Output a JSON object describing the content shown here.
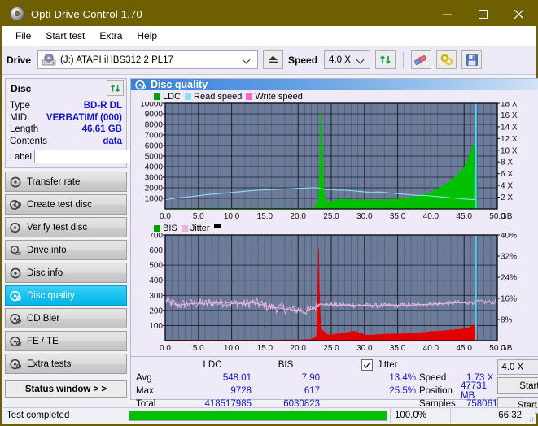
{
  "window": {
    "title": "Opti Drive Control 1.70",
    "icon": "disc-icon",
    "minimize": "–",
    "maximize": "□",
    "close": "✕"
  },
  "menubar": {
    "items": [
      {
        "label": "File"
      },
      {
        "label": "Start test"
      },
      {
        "label": "Extra"
      },
      {
        "label": "Help"
      }
    ]
  },
  "toolbar": {
    "drive_label": "Drive",
    "drive_value": "(J:)   ATAPI iHBS312  2 PL17",
    "eject_title": "eject-button",
    "speed_label": "Speed",
    "speed_value": "4.0 X",
    "refresh_title": "refresh-button",
    "erase_title": "erase-button",
    "tools_title": "tools-button",
    "save_title": "save-button"
  },
  "disc_panel": {
    "title": "Disc",
    "refresh_title": "refresh-disc-button",
    "rows": [
      {
        "key": "Type",
        "value": "BD-R DL"
      },
      {
        "key": "MID",
        "value": "VERBATIMf (000)"
      },
      {
        "key": "Length",
        "value": "46.61 GB"
      },
      {
        "key": "Contents",
        "value": "data"
      }
    ],
    "label_key": "Label",
    "label_value": "",
    "label_placeholder": ""
  },
  "nav": {
    "items": [
      {
        "label": "Transfer rate",
        "active": false
      },
      {
        "label": "Create test disc",
        "active": false
      },
      {
        "label": "Verify test disc",
        "active": false
      },
      {
        "label": "Drive info",
        "active": false
      },
      {
        "label": "Disc info",
        "active": false
      },
      {
        "label": "Disc quality",
        "active": true
      },
      {
        "label": "CD Bler",
        "active": false
      },
      {
        "label": "FE / TE",
        "active": false
      },
      {
        "label": "Extra tests",
        "active": false
      }
    ],
    "status_window": "Status window > >"
  },
  "main": {
    "header_title": "Disc quality",
    "header_icon": "disc-quality-icon"
  },
  "stats": {
    "col_headers": [
      "LDC",
      "BIS"
    ],
    "jitter_label": "Jitter",
    "jitter_checked": true,
    "rows": [
      {
        "label": "Avg",
        "ldc": "548.01",
        "bis": "7.90",
        "jitter": "13.4%"
      },
      {
        "label": "Max",
        "ldc": "9728",
        "bis": "617",
        "jitter": "25.5%"
      },
      {
        "label": "Total",
        "ldc": "418517985",
        "bis": "6030823",
        "jitter": ""
      }
    ],
    "right": [
      {
        "label": "Speed",
        "value": "1.73 X"
      },
      {
        "label": "Position",
        "value": "47731 MB"
      },
      {
        "label": "Samples",
        "value": "758061"
      }
    ],
    "speed_select": "4.0 X",
    "start_full": "Start full",
    "start_part": "Start part"
  },
  "statusbar": {
    "text": "Test completed",
    "progress_percent": "100.0%",
    "progress_value": 100,
    "elapsed": "66:32"
  },
  "colors": {
    "titlebar": "#6e6000",
    "accent_blue": "#1414c8",
    "plot_bg": "#6b7b99",
    "grid": "#2a2a33",
    "ldc_green": "#00c000",
    "bis_red": "#e00000",
    "bis_orange": "#f0a000",
    "jitter_pink": "#e6b4e0",
    "read_speed": "#8fdcf5",
    "write_speed": "#ff66cc",
    "progress_green": "#00c000",
    "nav_active": "#16c2ef"
  },
  "chart_data": [
    {
      "id": "ldc-chart",
      "type": "area",
      "title": "",
      "xlabel": "GB",
      "ylabel": "",
      "legend": [
        {
          "name": "LDC",
          "color": "#00a000"
        },
        {
          "name": "Read speed",
          "color": "#8fdcf5"
        },
        {
          "name": "Write speed",
          "color": "#ff66cc"
        }
      ],
      "legend_position": "top-left",
      "grid": true,
      "xlim": [
        0,
        50
      ],
      "xticks": [
        "0.0",
        "5.0",
        "10.0",
        "15.0",
        "20.0",
        "25.0",
        "30.0",
        "35.0",
        "40.0",
        "45.0",
        "50.0"
      ],
      "xtick_suffix": "GB",
      "ylim": [
        0,
        10000
      ],
      "yticks": [
        "10000",
        "9000",
        "8000",
        "7000",
        "6000",
        "5000",
        "4000",
        "3000",
        "2000",
        "1000"
      ],
      "y2lim": [
        0,
        18
      ],
      "y2ticks": [
        "18 X",
        "16 X",
        "14 X",
        "12 X",
        "10 X",
        "8 X",
        "6 X",
        "4 X",
        "2 X"
      ],
      "series": [
        {
          "name": "LDC",
          "color": "#00c000",
          "kind": "area",
          "x": [
            0,
            1,
            2,
            3,
            4,
            5,
            6,
            7,
            8,
            9,
            10,
            11,
            12,
            13,
            14,
            15,
            16,
            17,
            18,
            19,
            20,
            21,
            22,
            22.5,
            23,
            23.2,
            23.4,
            23.6,
            23.8,
            24,
            24.3,
            24.6,
            25,
            25.5,
            26,
            26.5,
            27,
            27.5,
            28,
            28.5,
            29,
            29.5,
            30,
            31,
            32,
            33,
            34,
            35,
            36,
            37,
            38,
            39,
            40,
            41,
            42,
            43,
            44,
            45,
            45.5,
            46,
            46.3,
            46.6,
            46.8,
            47
          ],
          "y": [
            60,
            60,
            60,
            60,
            60,
            60,
            60,
            60,
            60,
            60,
            60,
            60,
            60,
            60,
            60,
            60,
            60,
            60,
            60,
            60,
            60,
            60,
            70,
            120,
            600,
            3000,
            9728,
            7000,
            3000,
            1400,
            700,
            640,
            760,
            820,
            860,
            900,
            920,
            900,
            880,
            880,
            870,
            860,
            850,
            840,
            850,
            880,
            900,
            940,
            1000,
            1100,
            1250,
            1400,
            1600,
            1900,
            2250,
            2700,
            3250,
            3900,
            4600,
            5400,
            5900,
            6150,
            6200,
            80
          ]
        },
        {
          "name": "Read speed",
          "color": "#8fdcf5",
          "kind": "line",
          "axis": "y2",
          "x": [
            0,
            2,
            4,
            6,
            8,
            10,
            12,
            14,
            16,
            18,
            20,
            22,
            23,
            24,
            25,
            26,
            27,
            28,
            29,
            30,
            31,
            32,
            33,
            34,
            35,
            36,
            37,
            38,
            39,
            40,
            41,
            42,
            43,
            44,
            45,
            46,
            46.6,
            46.7,
            46.8
          ],
          "y": [
            1.6,
            1.9,
            2.1,
            2.4,
            2.6,
            2.8,
            3.0,
            3.2,
            3.3,
            3.4,
            3.5,
            3.6,
            3.6,
            3.3,
            3.3,
            3.2,
            3.2,
            3.1,
            3.0,
            2.9,
            2.8,
            2.9,
            2.8,
            2.7,
            2.6,
            2.5,
            2.4,
            2.3,
            2.3,
            2.2,
            2.1,
            2.0,
            1.9,
            1.8,
            1.7,
            1.6,
            1.6,
            18,
            18
          ]
        }
      ]
    },
    {
      "id": "bis-chart",
      "type": "area",
      "title": "",
      "xlabel": "GB",
      "legend": [
        {
          "name": "BIS",
          "color": "#00a000"
        },
        {
          "name": "Jitter",
          "color": "#e6b4e0"
        },
        {
          "name": "",
          "color": "#000000"
        }
      ],
      "legend_position": "top-left",
      "grid": true,
      "xlim": [
        0,
        50
      ],
      "xticks": [
        "0.0",
        "5.0",
        "10.0",
        "15.0",
        "20.0",
        "25.0",
        "30.0",
        "35.0",
        "40.0",
        "45.0",
        "50.0"
      ],
      "xtick_suffix": "GB",
      "ylim": [
        0,
        700
      ],
      "yticks": [
        "700",
        "600",
        "500",
        "400",
        "300",
        "200",
        "100"
      ],
      "y2lim": [
        0,
        40
      ],
      "y2ticks": [
        "40%",
        "32%",
        "24%",
        "16%",
        "8%"
      ],
      "series": [
        {
          "name": "BIS",
          "color": "#e00000",
          "kind": "area",
          "x": [
            0,
            5,
            10,
            15,
            20,
            22,
            22.8,
            23,
            23.1,
            23.2,
            23.4,
            23.6,
            24,
            24.5,
            25,
            25.5,
            26,
            26.5,
            27,
            27.5,
            28,
            28.5,
            29,
            29.5,
            30,
            31,
            32,
            33,
            34,
            35,
            36,
            37,
            38,
            39,
            40,
            41,
            42,
            43,
            44,
            45,
            46,
            46.5,
            46.8,
            47
          ],
          "y": [
            4,
            4,
            4,
            4,
            5,
            8,
            30,
            450,
            617,
            330,
            120,
            70,
            55,
            40,
            38,
            42,
            45,
            48,
            50,
            55,
            60,
            62,
            55,
            50,
            38,
            36,
            40,
            42,
            45,
            44,
            46,
            48,
            52,
            55,
            60,
            62,
            66,
            70,
            74,
            78,
            90,
            105,
            100,
            5
          ]
        },
        {
          "name": "Jitter",
          "color": "#e6b4e0",
          "kind": "line",
          "axis": "y2",
          "x": [
            0,
            1,
            2,
            3,
            4,
            5,
            6,
            7,
            8,
            9,
            10,
            11,
            12,
            13,
            14,
            15,
            16,
            17,
            18,
            19,
            20,
            21,
            22,
            22.5,
            23,
            23.5,
            24,
            25,
            26,
            27,
            28,
            29,
            30,
            31,
            32,
            33,
            34,
            35,
            36,
            37,
            38,
            39,
            40,
            41,
            42,
            43,
            44,
            45,
            46,
            46.8
          ],
          "y": [
            15.5,
            14.0,
            13.5,
            13.8,
            14.0,
            14.2,
            13.8,
            14.5,
            14.2,
            14.6,
            14.0,
            14.2,
            13.8,
            14.4,
            14.0,
            13.2,
            12.6,
            12.4,
            12.0,
            11.6,
            11.5,
            11.2,
            11.8,
            12.5,
            13.5,
            13.9,
            13.6,
            13.6,
            13.4,
            13.5,
            13.4,
            13.3,
            13.4,
            13.3,
            13.2,
            13.3,
            13.4,
            13.3,
            13.5,
            13.4,
            13.6,
            13.7,
            13.8,
            13.9,
            14.0,
            14.2,
            14.4,
            14.3,
            14.6,
            14.6
          ]
        }
      ],
      "markers": [
        {
          "name": "position-marker",
          "x": 46.8,
          "color": "#45d8f8"
        }
      ]
    }
  ]
}
